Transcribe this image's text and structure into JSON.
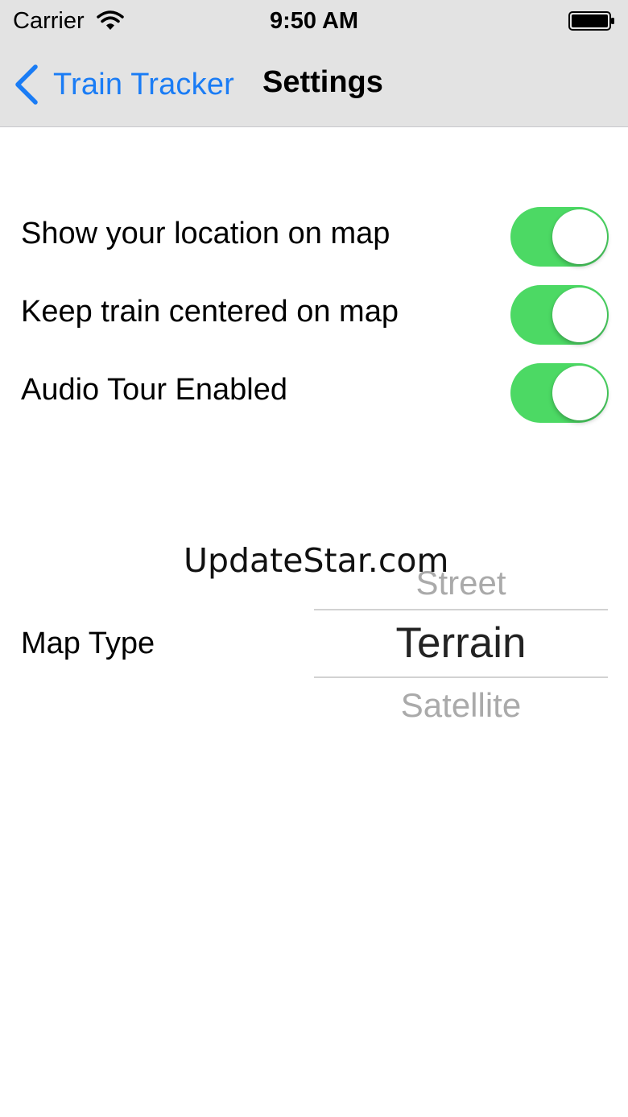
{
  "status_bar": {
    "carrier": "Carrier",
    "time": "9:50 AM",
    "wifi_icon": "wifi-icon",
    "battery_icon": "battery-full-icon"
  },
  "nav": {
    "back_label": "Train Tracker",
    "back_icon": "chevron-left-icon",
    "title": "Settings",
    "accent_color": "#1a7cf5"
  },
  "settings": {
    "items": [
      {
        "label": "Show your location on map",
        "enabled": true
      },
      {
        "label": "Keep train centered on map",
        "enabled": true
      },
      {
        "label": "Audio Tour Enabled",
        "enabled": true
      }
    ],
    "switch_on_color": "#4cd964"
  },
  "watermark": "UpdateStar.com",
  "map_type": {
    "label": "Map Type",
    "options": [
      "Street",
      "Terrain",
      "Satellite"
    ],
    "selected": "Terrain"
  }
}
